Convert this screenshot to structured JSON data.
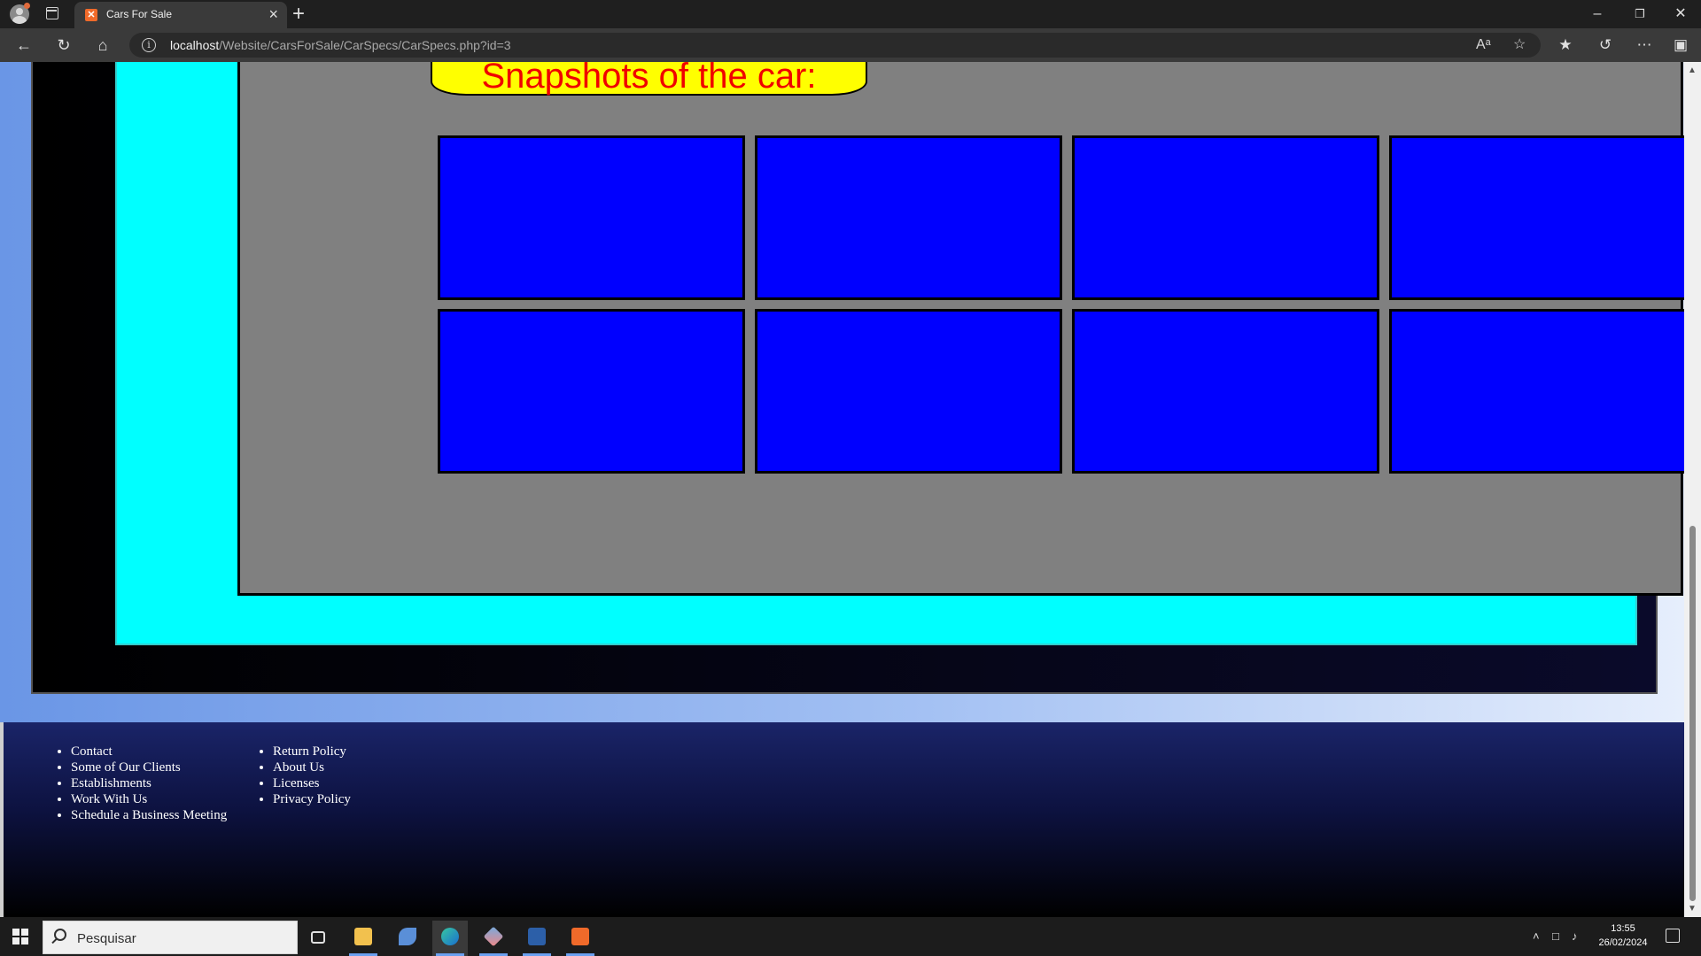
{
  "browser": {
    "tab_title": "Cars For Sale",
    "tab_favicon": "xampp-icon",
    "url_host": "localhost",
    "url_path": "/Website/CarsForSale/CarSpecs/CarSpecs.php?id=3"
  },
  "page": {
    "snapshots_heading": "Snapshots of the car:",
    "snapshots": [
      {
        "slot": 1
      },
      {
        "slot": 2
      },
      {
        "slot": 3
      },
      {
        "slot": 4
      },
      {
        "slot": 5
      },
      {
        "slot": 6
      },
      {
        "slot": 7
      },
      {
        "slot": 8
      }
    ],
    "colors": {
      "panel": "#808080",
      "frame": "#00ffff",
      "snapshot": "#0000ff",
      "heading_bg": "#ffff00",
      "heading_text": "#f00000"
    }
  },
  "footer": {
    "col1": [
      "Contact",
      "Some of Our Clients",
      "Establishments",
      "Work With Us",
      "Schedule a Business Meeting"
    ],
    "col2": [
      "Return Policy",
      "About Us",
      "Licenses",
      "Privacy Policy"
    ]
  },
  "taskbar": {
    "search_placeholder": "Pesquisar",
    "time": "13:55",
    "date": "26/02/2024"
  }
}
